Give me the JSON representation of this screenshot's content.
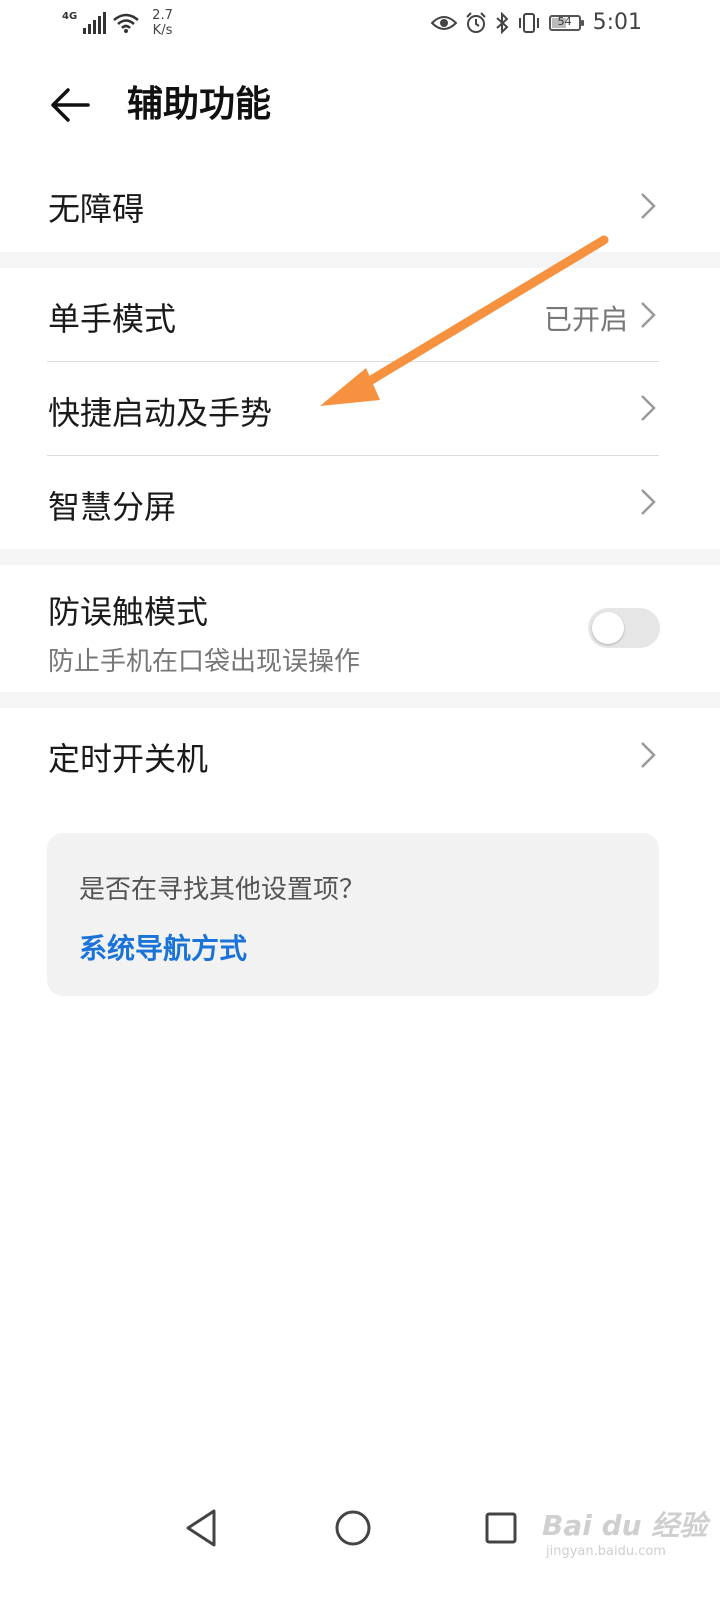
{
  "status_bar": {
    "network_type": "4G",
    "speed_value": "2.7",
    "speed_unit": "K/s",
    "battery_level": "54",
    "time": "5:01",
    "icons": [
      "signal-icon",
      "wifi-icon",
      "eye-comfort-icon",
      "alarm-icon",
      "bluetooth-icon",
      "vibrate-icon",
      "battery-icon"
    ]
  },
  "header": {
    "title": "辅助功能",
    "back_icon": "back-arrow-icon"
  },
  "settings": {
    "accessibility": {
      "label": "无障碍"
    },
    "one_hand": {
      "label": "单手模式",
      "value": "已开启"
    },
    "shortcuts": {
      "label": "快捷启动及手势"
    },
    "smart_split": {
      "label": "智慧分屏"
    },
    "mistouch": {
      "label": "防误触模式",
      "subtitle": "防止手机在口袋出现误操作",
      "enabled": false
    },
    "schedule_power": {
      "label": "定时开关机"
    }
  },
  "suggestion": {
    "question": "是否在寻找其他设置项？",
    "link": "系统导航方式"
  },
  "colors": {
    "link": "#1a73d9",
    "annotation_arrow": "#f5913f",
    "section_gap": "#f5f5f5",
    "card_bg": "#f2f2f2"
  },
  "watermark": {
    "brand": "Bai du 经验",
    "domain": "jingyan.baidu.com"
  }
}
